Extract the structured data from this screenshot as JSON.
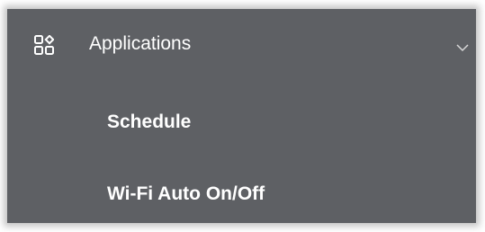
{
  "menu": {
    "header": {
      "label": "Applications",
      "icon": "apps-grid-icon",
      "expand_icon": "chevron-down-icon",
      "expanded": true
    },
    "items": [
      {
        "label": "Schedule"
      },
      {
        "label": "Wi-Fi Auto On/Off"
      }
    ]
  },
  "colors": {
    "panel_background": "#5e6064",
    "text": "#ffffff",
    "page_background": "#ffffff"
  }
}
